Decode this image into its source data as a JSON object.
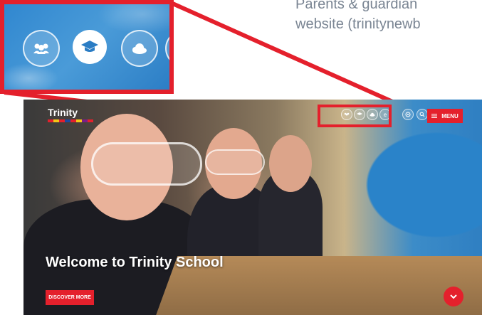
{
  "intro": {
    "line1": "Parents  &  guardian",
    "line2": "website (trinitynewb"
  },
  "site": {
    "logo_text": "Trinity",
    "logo_stripe_colors": [
      "#e4202c",
      "#f5c518",
      "#e4202c",
      "#1c4aa0",
      "#e4202c",
      "#f5c518",
      "#7b1e86",
      "#e4202c"
    ],
    "menu_label": "MENU",
    "hero_title": "Welcome to Trinity School",
    "discover_label": "DISCOVER MORE"
  },
  "toolbar_icons": [
    {
      "name": "crowd-icon"
    },
    {
      "name": "graduation-cap-icon"
    },
    {
      "name": "cloud-icon"
    },
    {
      "name": "e-icon",
      "glyph": "e"
    }
  ],
  "util_icons": [
    {
      "name": "accessibility-icon"
    },
    {
      "name": "search-icon"
    }
  ],
  "colors": {
    "accent": "#e4202c",
    "sky": "#2a7cc4"
  }
}
